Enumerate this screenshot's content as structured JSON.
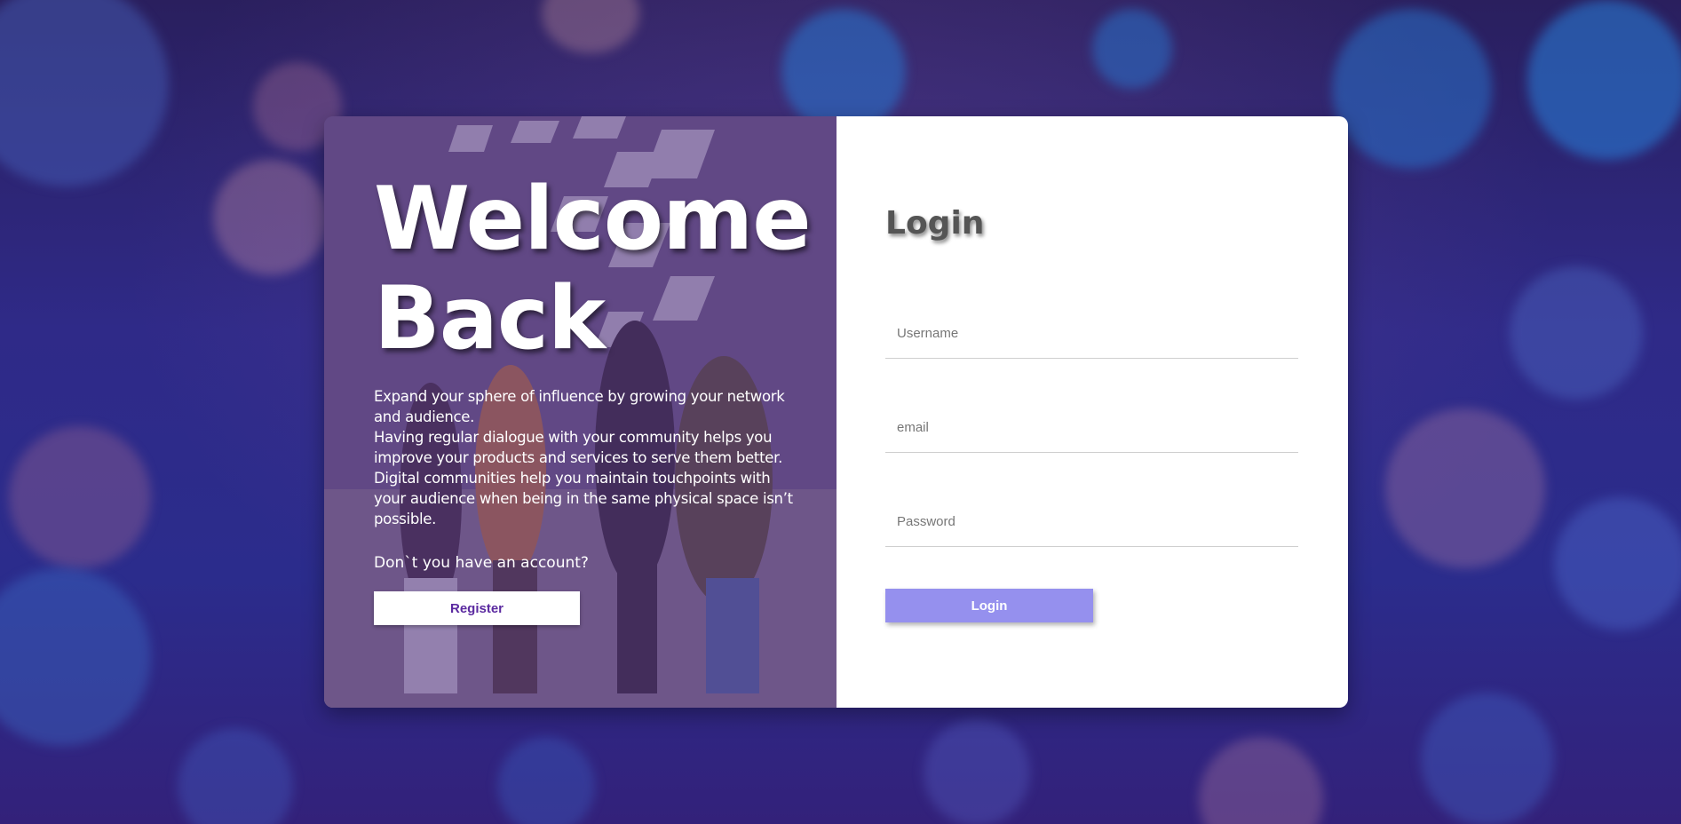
{
  "welcome": {
    "title": "Welcome\nBack",
    "description": "Expand your sphere of influence by growing your network and audience.\nHaving regular dialogue with your community helps you improve your products and services to serve them better. Digital communities help you maintain touchpoints with your audience when being in the same physical space isn’t possible.",
    "question": "Don`t you have an account?",
    "register_label": "Register"
  },
  "login": {
    "title": "Login",
    "username_placeholder": "Username",
    "email_placeholder": "email",
    "password_placeholder": "Password",
    "button_label": "Login"
  },
  "colors": {
    "accent": "#9590ee",
    "register_text": "#5b2aa0",
    "title_gray": "#555555"
  }
}
